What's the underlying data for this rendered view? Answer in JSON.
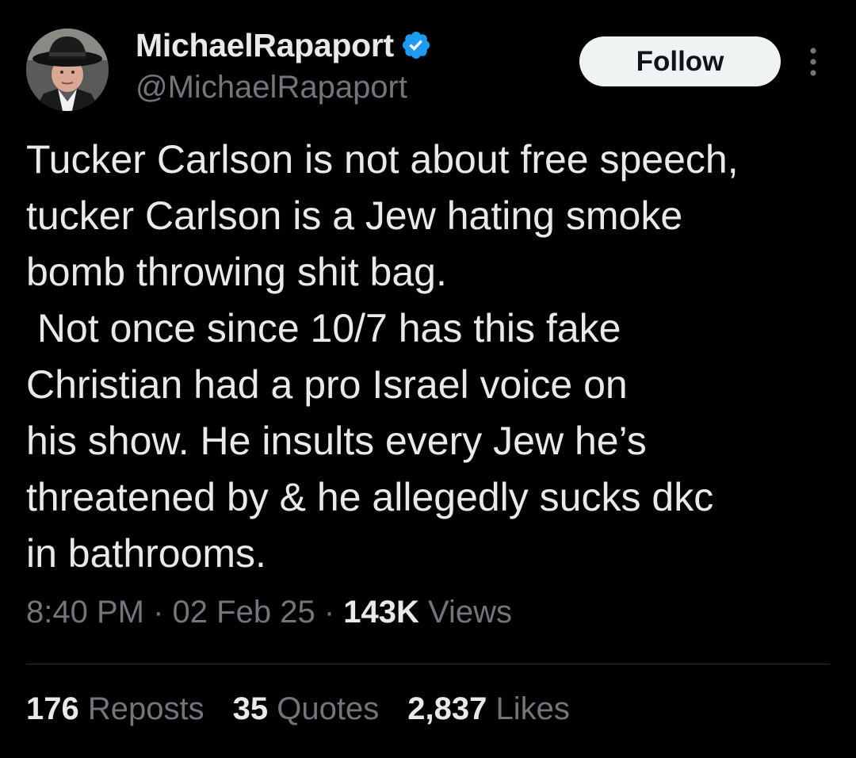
{
  "author": {
    "display_name": "MichaelRapaport",
    "handle": "@MichaelRapaport",
    "verified": true,
    "verified_color": "#1d9bf0"
  },
  "follow_label": "Follow",
  "more_icon": "more-vertical-icon",
  "tweet_lines": [
    "Tucker Carlson is not about free speech,",
    "tucker Carlson is a Jew hating smoke",
    "bomb throwing shit bag.",
    " Not once since 10/7 has this fake",
    "Christian had a pro Israel voice on",
    "his show. He insults every Jew he’s",
    "threatened by & he allegedly sucks dkc",
    "in bathrooms."
  ],
  "meta": {
    "time": "8:40 PM",
    "separator": "·",
    "date": "02 Feb 25",
    "views_count": "143K",
    "views_label": "Views"
  },
  "stats": {
    "reposts_count": "176",
    "reposts_label": "Reposts",
    "quotes_count": "35",
    "quotes_label": "Quotes",
    "likes_count": "2,837",
    "likes_label": "Likes"
  },
  "colors": {
    "background": "#000000",
    "text": "#e7e9ea",
    "secondary": "#71767b",
    "divider": "#2f3336",
    "button_bg": "#eff3f4"
  }
}
